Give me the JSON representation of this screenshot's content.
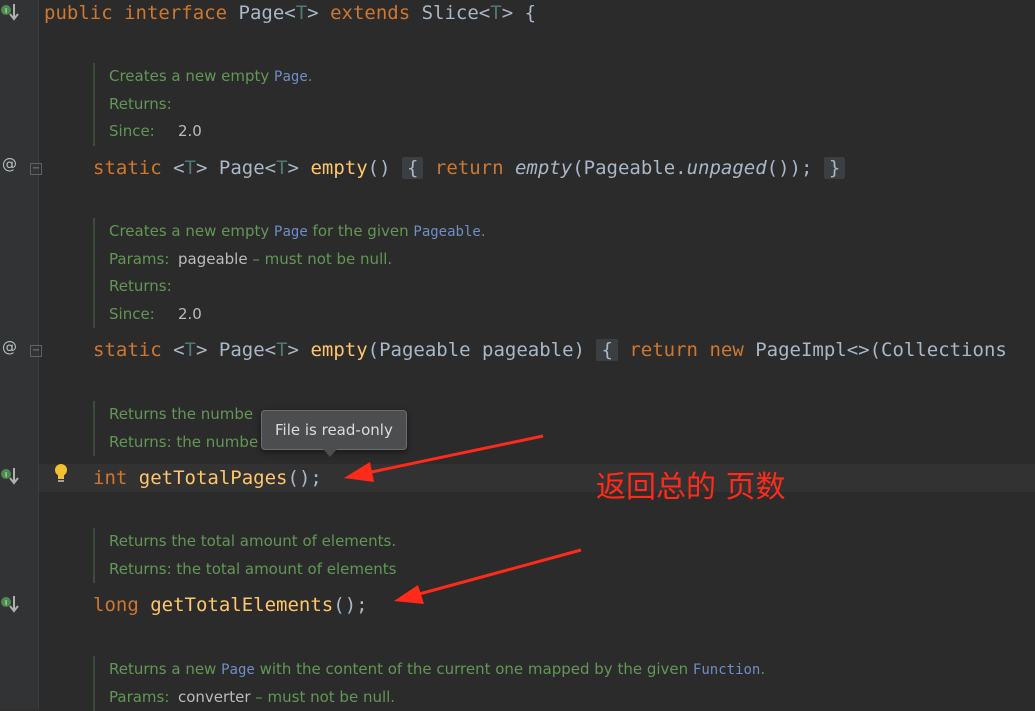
{
  "editor": {
    "line1": {
      "kw_public": "public",
      "kw_interface": "interface",
      "name": "Page",
      "type_param": "T",
      "kw_extends": "extends",
      "parent": "Slice",
      "brace": " {"
    },
    "doc1": {
      "text_a": "Creates a new empty ",
      "ref": "Page",
      "text_b": ".",
      "returns_label": "Returns:",
      "since_label": "Since:",
      "since_value": "2.0"
    },
    "method1": {
      "kw_static": "static",
      "type_param": "T",
      "ret": "Page",
      "name": "empty",
      "params": "()",
      "fold_open": "{",
      "kw_return": "return",
      "call": "empty",
      "arg_class": "Pageable.",
      "arg_method": "unpaged",
      "arg_tail": "());",
      "fold_close": "}"
    },
    "doc2": {
      "text_a": "Creates a new empty ",
      "ref1": "Page",
      "text_b": " for the given ",
      "ref2": "Pageable",
      "text_c": ".",
      "params_label": "Params:",
      "param_name": "pageable",
      "param_desc": " – must not be null.",
      "returns_label": "Returns:",
      "since_label": "Since:",
      "since_value": "2.0"
    },
    "method2": {
      "kw_static": "static",
      "type_param": "T",
      "ret": "Page",
      "name": "empty",
      "params": "(Pageable pageable)",
      "fold_open": "{",
      "kw_return": "return",
      "kw_new": "new",
      "tail": "PageImpl<>(Collections"
    },
    "doc3": {
      "line1": "Returns the numbe",
      "line2": "Returns:  the numbe"
    },
    "method3": {
      "kw_type": "int",
      "name": "getTotalPages",
      "tail": "();"
    },
    "doc4": {
      "line1": "Returns the total amount of elements.",
      "returns_label": "Returns:",
      "returns_value": " the total amount of elements"
    },
    "method4": {
      "kw_type": "long",
      "name": "getTotalElements",
      "tail": "();"
    },
    "doc5": {
      "text_a": "Returns a new ",
      "ref1": "Page",
      "text_b": " with the content of the current one mapped by the given ",
      "ref2": "Function",
      "text_c": ".",
      "params_label": "Params:",
      "param_name": "converter",
      "param_desc": " – must not be null."
    }
  },
  "tooltip": {
    "text": "File is read-only"
  },
  "annotation": {
    "text": "返回总的 页数",
    "color": "#ff2a1a"
  },
  "icons": {
    "implemented": "implemented-method-icon",
    "override": "annotation-at-icon",
    "fold": "fold-collapse-icon",
    "bulb": "lightbulb-icon"
  }
}
